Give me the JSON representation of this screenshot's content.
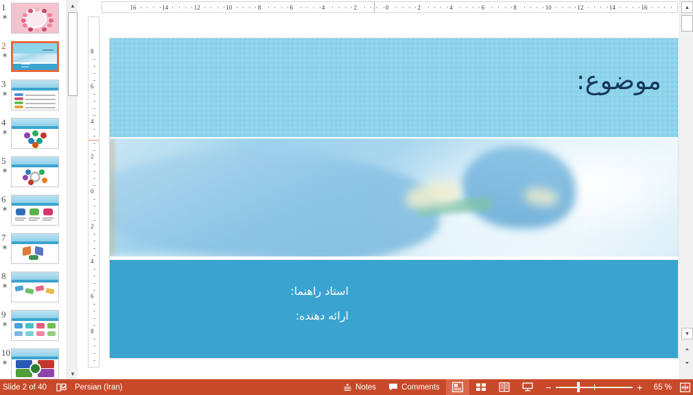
{
  "app": {
    "name": "PowerPoint",
    "view": "Normal"
  },
  "thumbnails": {
    "star_glyph": "✶",
    "slides": [
      {
        "number": "1",
        "selected": false,
        "kind": "floral-pink"
      },
      {
        "number": "2",
        "selected": true,
        "kind": "title-blue"
      },
      {
        "number": "3",
        "selected": false,
        "kind": "table"
      },
      {
        "number": "4",
        "selected": false,
        "kind": "hexagon"
      },
      {
        "number": "5",
        "selected": false,
        "kind": "circle"
      },
      {
        "number": "6",
        "selected": false,
        "kind": "speech"
      },
      {
        "number": "7",
        "selected": false,
        "kind": "arrows"
      },
      {
        "number": "8",
        "selected": false,
        "kind": "chevron"
      },
      {
        "number": "9",
        "selected": false,
        "kind": "cards"
      },
      {
        "number": "10",
        "selected": false,
        "kind": "quad"
      }
    ]
  },
  "rulers": {
    "horizontal": [
      "16",
      "14",
      "12",
      "10",
      "8",
      "6",
      "4",
      "2",
      "0",
      "2",
      "4",
      "6",
      "8",
      "10",
      "12",
      "14",
      "16"
    ],
    "vertical": [
      "8",
      "6",
      "4",
      "2",
      "0",
      "2",
      "4",
      "6",
      "8"
    ]
  },
  "slide": {
    "title": "موضوع:",
    "title_color": "#15375c",
    "header_bg": "#8ed4ea",
    "footer_bg": "#3ba3d0",
    "photo_alt": "operating-room-surgery-photo",
    "footer_lines": [
      "استاد راهنما:",
      "ارائه دهنده:"
    ]
  },
  "statusbar": {
    "slide_count": "Slide 2 of 40",
    "proofing_icon": "spell-check-icon",
    "language": "Persian (Iran)",
    "notes_label": "Notes",
    "comments_label": "Comments",
    "views": [
      {
        "name": "normal-view",
        "active": true
      },
      {
        "name": "slide-sorter-view",
        "active": false
      },
      {
        "name": "reading-view",
        "active": false
      },
      {
        "name": "slide-show-view",
        "active": false
      }
    ],
    "zoom_out": "−",
    "zoom_in": "+",
    "zoom_level": "65 %",
    "fit_label": "fit-slide-to-window",
    "bg_color": "#c8492a"
  }
}
